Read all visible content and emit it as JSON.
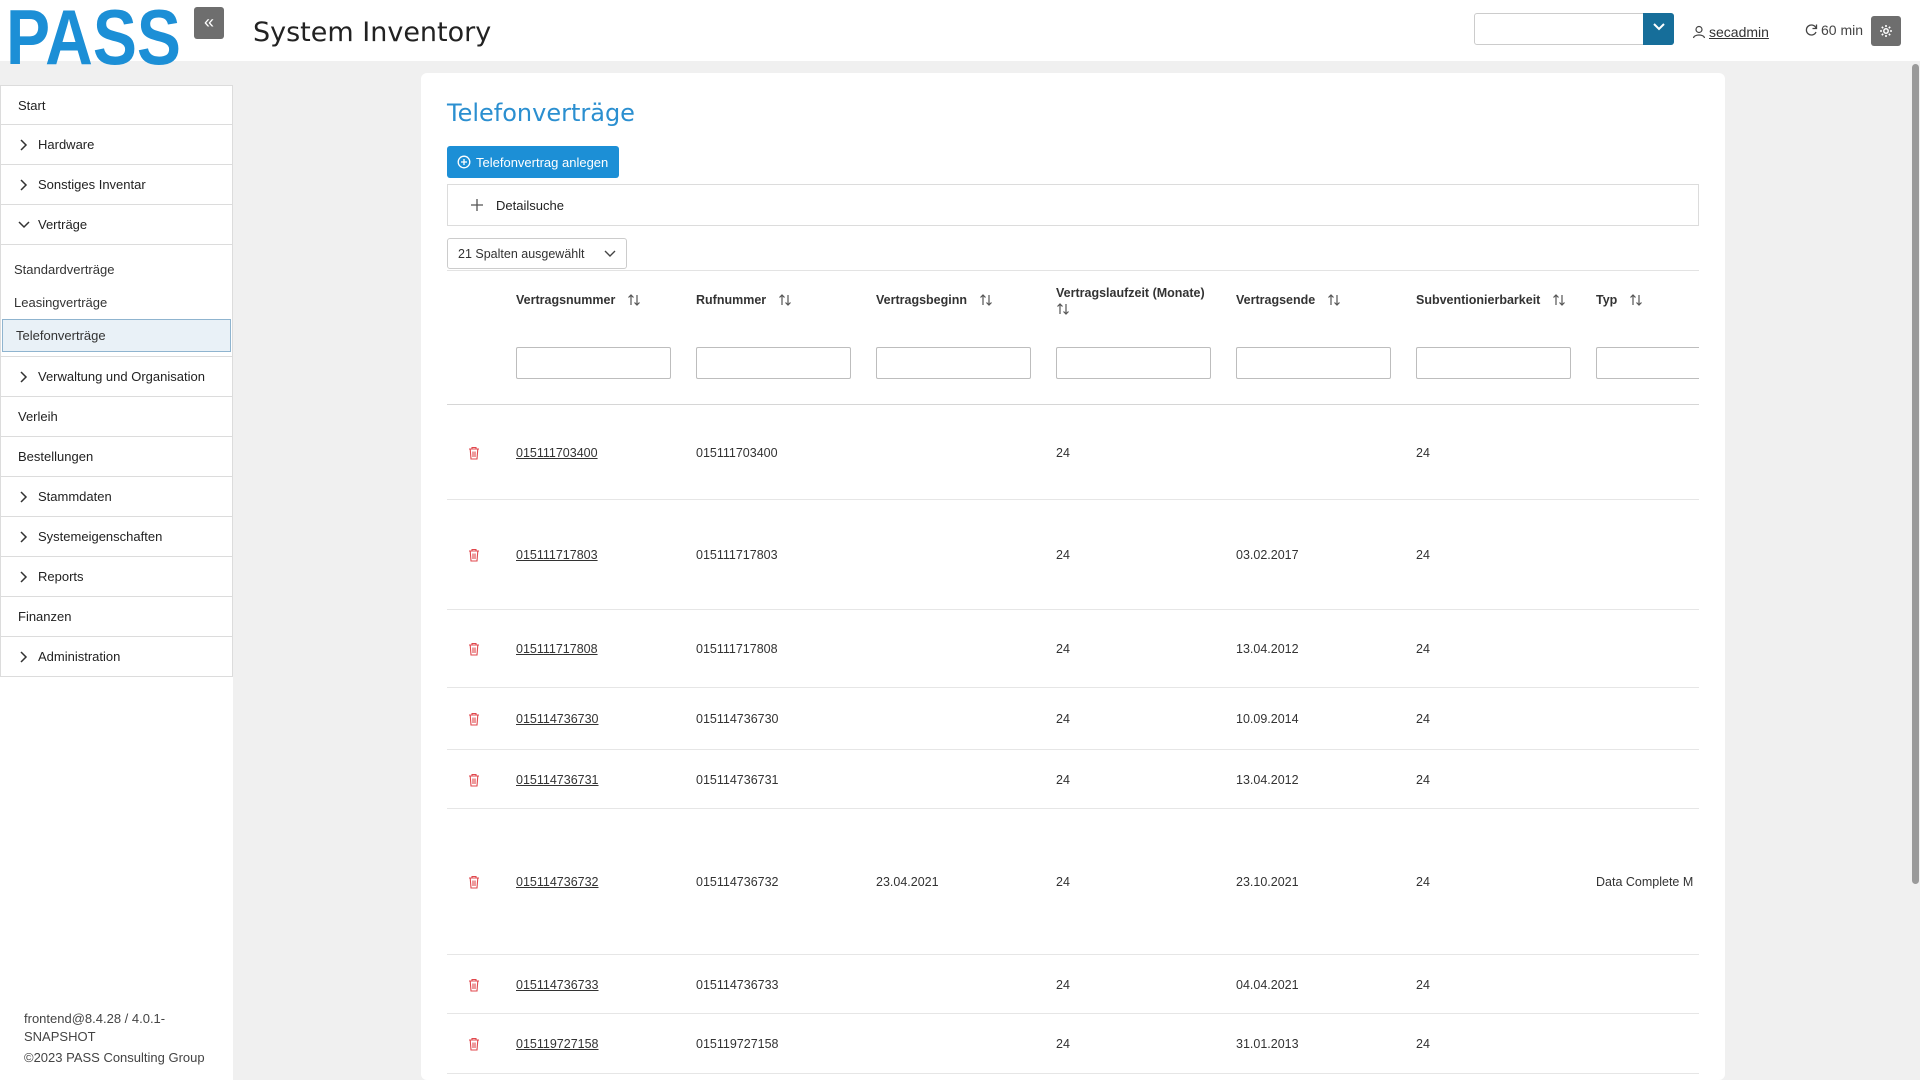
{
  "header": {
    "logo_text": "PASS",
    "title": "System Inventory",
    "user": "secadmin",
    "timer": "60 min"
  },
  "sidebar": {
    "items": [
      {
        "label": "Start",
        "chevron": "none"
      },
      {
        "label": "Hardware",
        "chevron": "right"
      },
      {
        "label": "Sonstiges Inventar",
        "chevron": "right"
      },
      {
        "label": "Verträge",
        "chevron": "down"
      }
    ],
    "sub_items": [
      {
        "label": "Standardverträge"
      },
      {
        "label": "Leasingverträge"
      },
      {
        "label": "Telefonverträge"
      }
    ],
    "items_after": [
      {
        "label": "Verwaltung und Organisation",
        "chevron": "right"
      },
      {
        "label": "Verleih",
        "chevron": "none"
      },
      {
        "label": "Bestellungen",
        "chevron": "none"
      },
      {
        "label": "Stammdaten",
        "chevron": "right"
      },
      {
        "label": "Systemeigenschaften",
        "chevron": "right"
      },
      {
        "label": "Reports",
        "chevron": "right"
      },
      {
        "label": "Finanzen",
        "chevron": "none"
      },
      {
        "label": "Administration",
        "chevron": "right"
      }
    ],
    "footer_line1": "frontend@8.4.28 / 4.0.1-",
    "footer_line2": "SNAPSHOT",
    "footer_line3": "©2023 PASS Consulting Group"
  },
  "main": {
    "page_title": "Telefonverträge",
    "create_button": "Telefonvertrag anlegen",
    "detail_search": "Detailsuche",
    "columns_select": "21 Spalten ausgewählt",
    "columns": [
      {
        "label": "Vertragsnummer"
      },
      {
        "label": "Rufnummer"
      },
      {
        "label": "Vertragsbeginn"
      },
      {
        "label": "Vertragslaufzeit (Monate)"
      },
      {
        "label": "Vertragsende"
      },
      {
        "label": "Subventionierbarkeit"
      },
      {
        "label": "Typ"
      }
    ],
    "rows": [
      {
        "nummer": "015111703400",
        "rufnummer": "015111703400",
        "beginn": "",
        "laufzeit": "24",
        "ende": "",
        "subv": "24",
        "typ": ""
      },
      {
        "nummer": "015111717803",
        "rufnummer": "015111717803",
        "beginn": "",
        "laufzeit": "24",
        "ende": "03.02.2017",
        "subv": "24",
        "typ": ""
      },
      {
        "nummer": "015111717808",
        "rufnummer": "015111717808",
        "beginn": "",
        "laufzeit": "24",
        "ende": "13.04.2012",
        "subv": "24",
        "typ": ""
      },
      {
        "nummer": "015114736730",
        "rufnummer": "015114736730",
        "beginn": "",
        "laufzeit": "24",
        "ende": "10.09.2014",
        "subv": "24",
        "typ": ""
      },
      {
        "nummer": "015114736731",
        "rufnummer": "015114736731",
        "beginn": "",
        "laufzeit": "24",
        "ende": "13.04.2012",
        "subv": "24",
        "typ": ""
      },
      {
        "nummer": "015114736732",
        "rufnummer": "015114736732",
        "beginn": "23.04.2021",
        "laufzeit": "24",
        "ende": "23.10.2021",
        "subv": "24",
        "typ": "Data Complete M"
      },
      {
        "nummer": "015114736733",
        "rufnummer": "015114736733",
        "beginn": "",
        "laufzeit": "24",
        "ende": "04.04.2021",
        "subv": "24",
        "typ": ""
      },
      {
        "nummer": "015119727158",
        "rufnummer": "015119727158",
        "beginn": "",
        "laufzeit": "24",
        "ende": "31.01.2013",
        "subv": "24",
        "typ": ""
      }
    ]
  },
  "colors": {
    "brand": "#1c8fd6",
    "title": "#2b8fd0",
    "delete": "#e0474c"
  }
}
